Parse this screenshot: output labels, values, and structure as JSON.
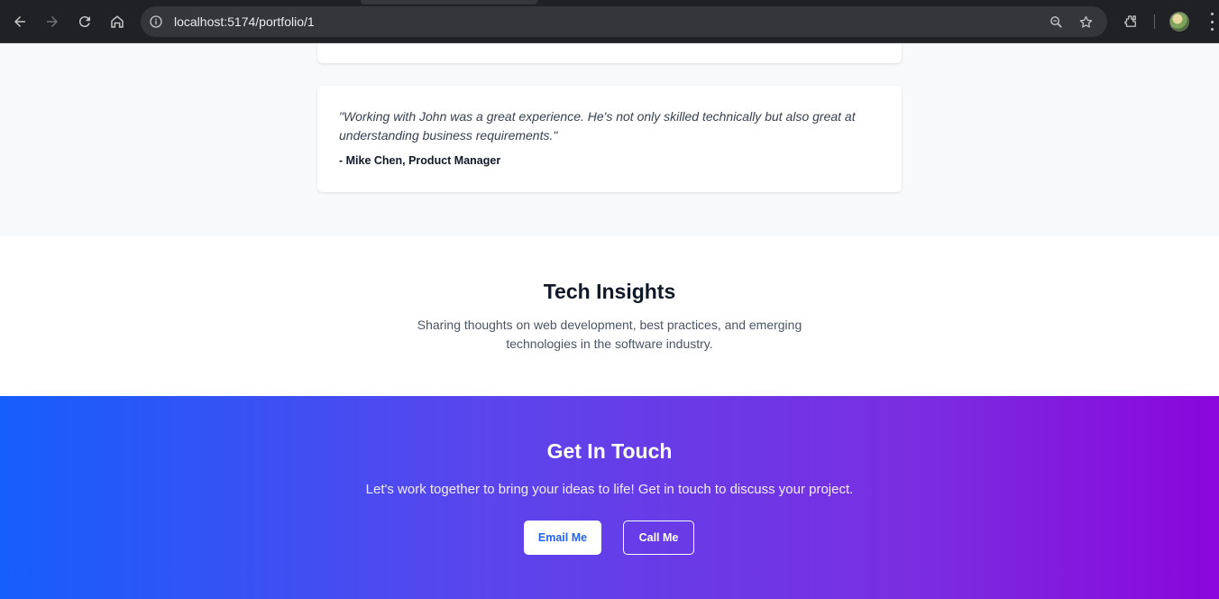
{
  "browser": {
    "url": "localhost:5174/portfolio/1",
    "icons": [
      "back-icon",
      "forward-icon",
      "reload-icon",
      "home-icon",
      "site-info-icon",
      "zoom-icon",
      "bookmark-star-icon",
      "extensions-icon",
      "profile-avatar",
      "menu-icon"
    ]
  },
  "testimonials": {
    "items": [
      {
        "quote": "\"Working with John was a great experience. He's not only skilled technically but also great at understanding business requirements.\"",
        "author": "- Mike Chen, Product Manager"
      }
    ]
  },
  "insights": {
    "title": "Tech Insights",
    "description": "Sharing thoughts on web development, best practices, and emerging technologies in the software industry."
  },
  "contact": {
    "title": "Get In Touch",
    "description": "Let's work together to bring your ideas to life! Get in touch to discuss your project.",
    "email_label": "Email Me",
    "call_label": "Call Me",
    "gradient_start": "#155efc",
    "gradient_end": "#8a06dc"
  }
}
